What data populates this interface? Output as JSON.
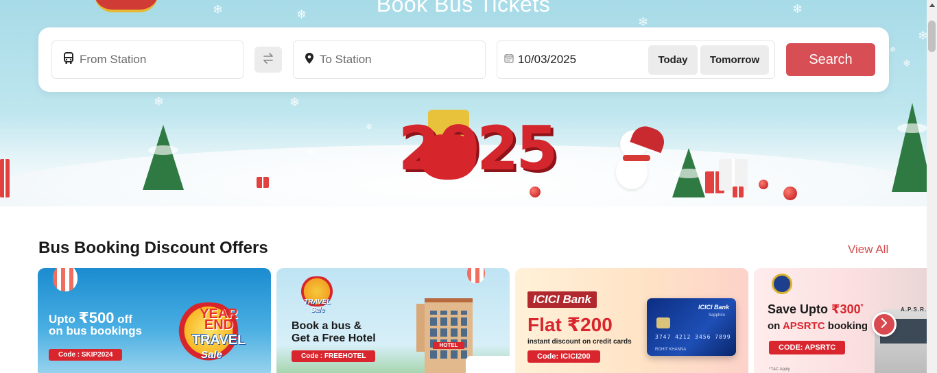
{
  "hero": {
    "title": "Book Bus Tickets",
    "year_art": "2025"
  },
  "search": {
    "from_placeholder": "From Station",
    "to_placeholder": "To Station",
    "date_value": "10/03/2025",
    "today_label": "Today",
    "tomorrow_label": "Tomorrow",
    "search_label": "Search"
  },
  "offers": {
    "title": "Bus Booking Discount Offers",
    "view_all_label": "View All",
    "cards": [
      {
        "line1_prefix": "Upto ",
        "amount": "₹500",
        "line1_suffix": " off",
        "line2": "on bus bookings",
        "code": "Code : SKIP2024",
        "badge_line1": "YEAR",
        "badge_line2": "END",
        "badge_line3": "TRAVEL",
        "badge_line4": "Sale"
      },
      {
        "line1": "Book a bus &",
        "line2": "Get a Free Hotel",
        "code": "Code : FREEHOTEL",
        "badge_line1": "TRAVEL",
        "badge_line2": "Sale",
        "hotel_sign": "HOTEL"
      },
      {
        "bank": "ICICI Bank",
        "headline_prefix": "Flat ",
        "amount": "₹200",
        "subline": "instant discount on credit cards",
        "code": "Code: ICICI200",
        "card_bank": "ICICI Bank",
        "card_tier": "Sapphiro",
        "card_number": "3747 4212 3456 7899",
        "card_name": "ROHIT KHANNA"
      },
      {
        "line1_prefix": "Save Upto ",
        "amount": "₹300",
        "amount_mark": "*",
        "line2_prefix": "on ",
        "line2_brand": "APSRTC",
        "line2_suffix": " booking",
        "code": "CODE: APSRTC",
        "bus_label": "A.P.S.R.T.C",
        "tnc": "*T&C Apply"
      }
    ]
  },
  "colors": {
    "accent": "#d84e55",
    "link": "#d54b4c",
    "sky": "#a7dbe7"
  }
}
